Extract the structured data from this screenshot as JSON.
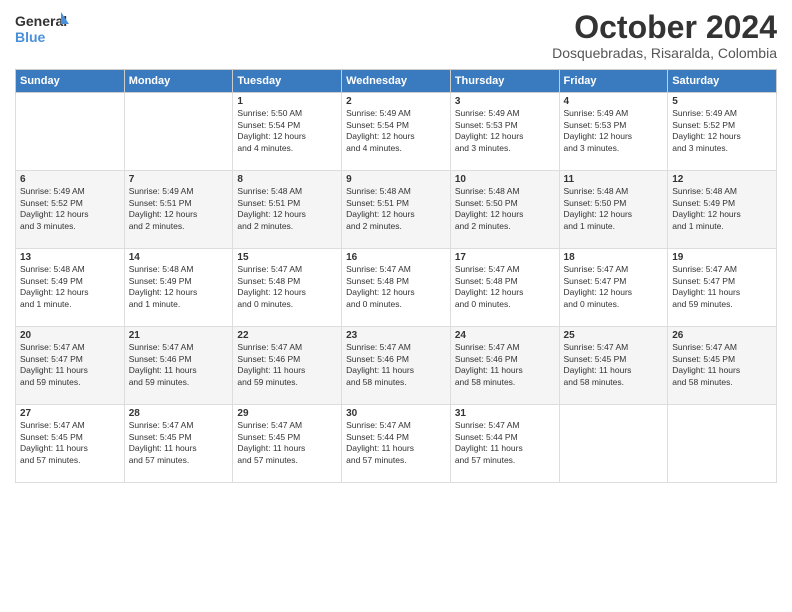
{
  "logo": {
    "line1": "General",
    "line2": "Blue"
  },
  "title": "October 2024",
  "subtitle": "Dosquebradas, Risaralda, Colombia",
  "days_header": [
    "Sunday",
    "Monday",
    "Tuesday",
    "Wednesday",
    "Thursday",
    "Friday",
    "Saturday"
  ],
  "weeks": [
    [
      {
        "day": "",
        "info": ""
      },
      {
        "day": "",
        "info": ""
      },
      {
        "day": "1",
        "info": "Sunrise: 5:50 AM\nSunset: 5:54 PM\nDaylight: 12 hours\nand 4 minutes."
      },
      {
        "day": "2",
        "info": "Sunrise: 5:49 AM\nSunset: 5:54 PM\nDaylight: 12 hours\nand 4 minutes."
      },
      {
        "day": "3",
        "info": "Sunrise: 5:49 AM\nSunset: 5:53 PM\nDaylight: 12 hours\nand 3 minutes."
      },
      {
        "day": "4",
        "info": "Sunrise: 5:49 AM\nSunset: 5:53 PM\nDaylight: 12 hours\nand 3 minutes."
      },
      {
        "day": "5",
        "info": "Sunrise: 5:49 AM\nSunset: 5:52 PM\nDaylight: 12 hours\nand 3 minutes."
      }
    ],
    [
      {
        "day": "6",
        "info": "Sunrise: 5:49 AM\nSunset: 5:52 PM\nDaylight: 12 hours\nand 3 minutes."
      },
      {
        "day": "7",
        "info": "Sunrise: 5:49 AM\nSunset: 5:51 PM\nDaylight: 12 hours\nand 2 minutes."
      },
      {
        "day": "8",
        "info": "Sunrise: 5:48 AM\nSunset: 5:51 PM\nDaylight: 12 hours\nand 2 minutes."
      },
      {
        "day": "9",
        "info": "Sunrise: 5:48 AM\nSunset: 5:51 PM\nDaylight: 12 hours\nand 2 minutes."
      },
      {
        "day": "10",
        "info": "Sunrise: 5:48 AM\nSunset: 5:50 PM\nDaylight: 12 hours\nand 2 minutes."
      },
      {
        "day": "11",
        "info": "Sunrise: 5:48 AM\nSunset: 5:50 PM\nDaylight: 12 hours\nand 1 minute."
      },
      {
        "day": "12",
        "info": "Sunrise: 5:48 AM\nSunset: 5:49 PM\nDaylight: 12 hours\nand 1 minute."
      }
    ],
    [
      {
        "day": "13",
        "info": "Sunrise: 5:48 AM\nSunset: 5:49 PM\nDaylight: 12 hours\nand 1 minute."
      },
      {
        "day": "14",
        "info": "Sunrise: 5:48 AM\nSunset: 5:49 PM\nDaylight: 12 hours\nand 1 minute."
      },
      {
        "day": "15",
        "info": "Sunrise: 5:47 AM\nSunset: 5:48 PM\nDaylight: 12 hours\nand 0 minutes."
      },
      {
        "day": "16",
        "info": "Sunrise: 5:47 AM\nSunset: 5:48 PM\nDaylight: 12 hours\nand 0 minutes."
      },
      {
        "day": "17",
        "info": "Sunrise: 5:47 AM\nSunset: 5:48 PM\nDaylight: 12 hours\nand 0 minutes."
      },
      {
        "day": "18",
        "info": "Sunrise: 5:47 AM\nSunset: 5:47 PM\nDaylight: 12 hours\nand 0 minutes."
      },
      {
        "day": "19",
        "info": "Sunrise: 5:47 AM\nSunset: 5:47 PM\nDaylight: 11 hours\nand 59 minutes."
      }
    ],
    [
      {
        "day": "20",
        "info": "Sunrise: 5:47 AM\nSunset: 5:47 PM\nDaylight: 11 hours\nand 59 minutes."
      },
      {
        "day": "21",
        "info": "Sunrise: 5:47 AM\nSunset: 5:46 PM\nDaylight: 11 hours\nand 59 minutes."
      },
      {
        "day": "22",
        "info": "Sunrise: 5:47 AM\nSunset: 5:46 PM\nDaylight: 11 hours\nand 59 minutes."
      },
      {
        "day": "23",
        "info": "Sunrise: 5:47 AM\nSunset: 5:46 PM\nDaylight: 11 hours\nand 58 minutes."
      },
      {
        "day": "24",
        "info": "Sunrise: 5:47 AM\nSunset: 5:46 PM\nDaylight: 11 hours\nand 58 minutes."
      },
      {
        "day": "25",
        "info": "Sunrise: 5:47 AM\nSunset: 5:45 PM\nDaylight: 11 hours\nand 58 minutes."
      },
      {
        "day": "26",
        "info": "Sunrise: 5:47 AM\nSunset: 5:45 PM\nDaylight: 11 hours\nand 58 minutes."
      }
    ],
    [
      {
        "day": "27",
        "info": "Sunrise: 5:47 AM\nSunset: 5:45 PM\nDaylight: 11 hours\nand 57 minutes."
      },
      {
        "day": "28",
        "info": "Sunrise: 5:47 AM\nSunset: 5:45 PM\nDaylight: 11 hours\nand 57 minutes."
      },
      {
        "day": "29",
        "info": "Sunrise: 5:47 AM\nSunset: 5:45 PM\nDaylight: 11 hours\nand 57 minutes."
      },
      {
        "day": "30",
        "info": "Sunrise: 5:47 AM\nSunset: 5:44 PM\nDaylight: 11 hours\nand 57 minutes."
      },
      {
        "day": "31",
        "info": "Sunrise: 5:47 AM\nSunset: 5:44 PM\nDaylight: 11 hours\nand 57 minutes."
      },
      {
        "day": "",
        "info": ""
      },
      {
        "day": "",
        "info": ""
      }
    ]
  ]
}
